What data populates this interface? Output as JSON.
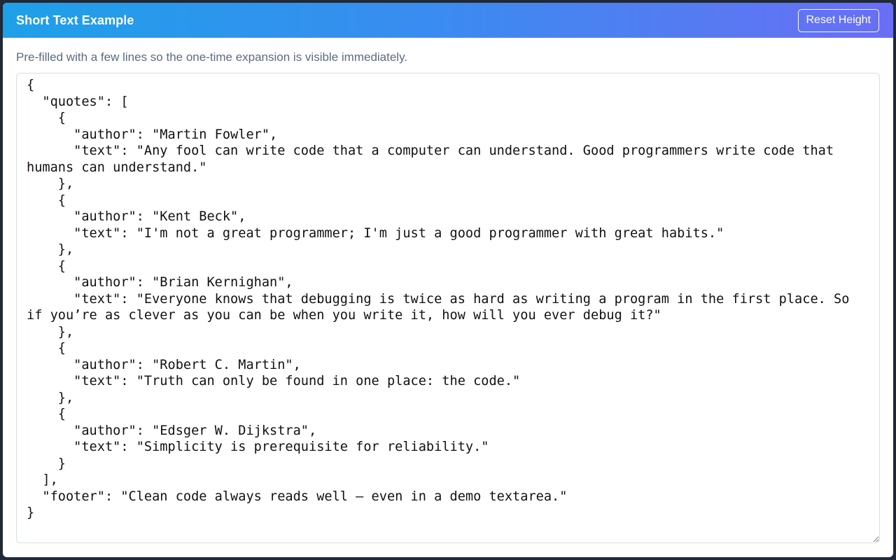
{
  "header": {
    "title": "Short Text Example",
    "reset_label": "Reset Height"
  },
  "main": {
    "description": "Pre-filled with a few lines so the one-time expansion is visible immediately.",
    "textarea_value": "{\n  \"quotes\": [\n    {\n      \"author\": \"Martin Fowler\",\n      \"text\": \"Any fool can write code that a computer can understand. Good programmers write code that humans can understand.\"\n    },\n    {\n      \"author\": \"Kent Beck\",\n      \"text\": \"I'm not a great programmer; I'm just a good programmer with great habits.\"\n    },\n    {\n      \"author\": \"Brian Kernighan\",\n      \"text\": \"Everyone knows that debugging is twice as hard as writing a program in the first place. So if you’re as clever as you can be when you write it, how will you ever debug it?\"\n    },\n    {\n      \"author\": \"Robert C. Martin\",\n      \"text\": \"Truth can only be found in one place: the code.\"\n    },\n    {\n      \"author\": \"Edsger W. Dijkstra\",\n      \"text\": \"Simplicity is prerequisite for reliability.\"\n    }\n  ],\n  \"footer\": \"Clean code always reads well — even in a demo textarea.\"\n}"
  },
  "colors": {
    "header_gradient_start": "#1ea0e9",
    "header_gradient_end": "#6a6ef4",
    "description_text": "#5b6b82",
    "textarea_border": "#d6dde6"
  }
}
